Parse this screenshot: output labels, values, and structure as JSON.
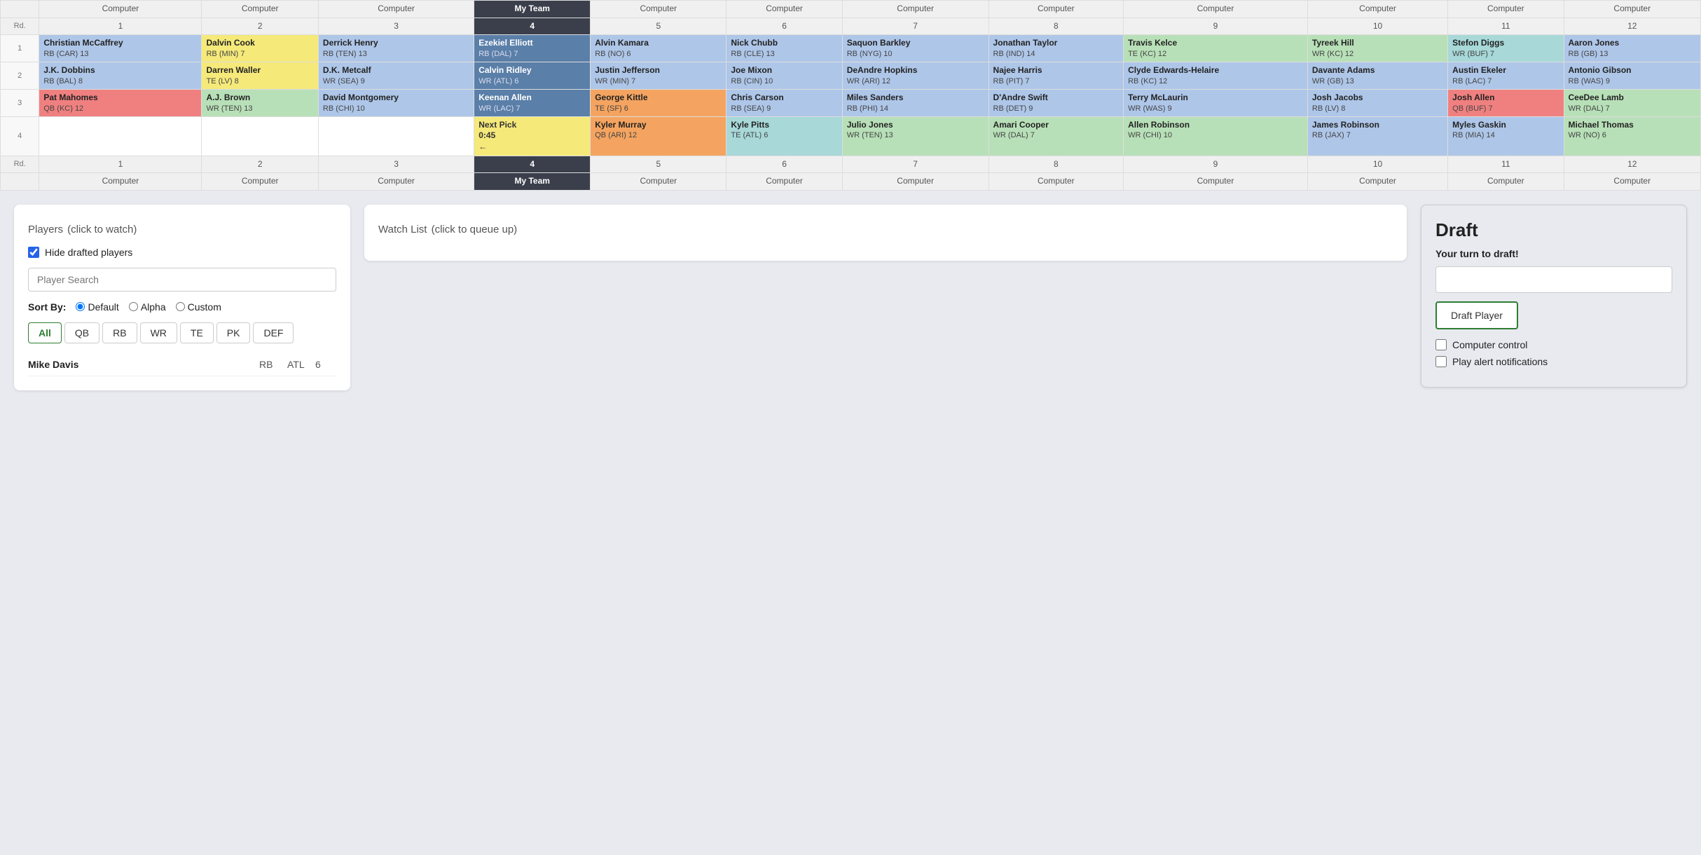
{
  "colors": {
    "my_team_header": "#3a3f4b",
    "blue": "#aec6e8",
    "green": "#b8e0b8",
    "yellow": "#f5e97a",
    "orange": "#f4a460",
    "red": "#f08080",
    "teal": "#a8d8d8"
  },
  "draft_board": {
    "headers": [
      "",
      "Computer",
      "Computer",
      "Computer",
      "My Team",
      "Computer",
      "Computer",
      "Computer",
      "Computer",
      "Computer",
      "Computer",
      "Computer",
      "Computer"
    ],
    "round_numbers": [
      "Rd.",
      "1",
      "2",
      "3",
      "4",
      "5",
      "6",
      "7",
      "8",
      "9",
      "10",
      "11",
      "12"
    ],
    "rounds": [
      {
        "round": "1",
        "picks": [
          {
            "name": "Christian McCaffrey",
            "meta": "RB (CAR) 13",
            "color": "blue"
          },
          {
            "name": "Dalvin Cook",
            "meta": "RB (MIN) 7",
            "color": "yellow"
          },
          {
            "name": "Derrick Henry",
            "meta": "RB (TEN) 13",
            "color": "blue"
          },
          {
            "name": "Ezekiel Elliott",
            "meta": "RB (DAL) 7",
            "color": "my-team",
            "is_my_team": true
          },
          {
            "name": "Alvin Kamara",
            "meta": "RB (NO) 6",
            "color": "blue"
          },
          {
            "name": "Nick Chubb",
            "meta": "RB (CLE) 13",
            "color": "blue"
          },
          {
            "name": "Saquon Barkley",
            "meta": "RB (NYG) 10",
            "color": "blue"
          },
          {
            "name": "Jonathan Taylor",
            "meta": "RB (IND) 14",
            "color": "blue"
          },
          {
            "name": "Travis Kelce",
            "meta": "TE (KC) 12",
            "color": "green"
          },
          {
            "name": "Tyreek Hill",
            "meta": "WR (KC) 12",
            "color": "green"
          },
          {
            "name": "Stefon Diggs",
            "meta": "WR (BUF) 7",
            "color": "teal"
          },
          {
            "name": "Aaron Jones",
            "meta": "RB (GB) 13",
            "color": "blue"
          }
        ]
      },
      {
        "round": "2",
        "picks": [
          {
            "name": "J.K. Dobbins",
            "meta": "RB (BAL) 8",
            "color": "blue"
          },
          {
            "name": "Darren Waller",
            "meta": "TE (LV) 8",
            "color": "yellow"
          },
          {
            "name": "D.K. Metcalf",
            "meta": "WR (SEA) 9",
            "color": "blue"
          },
          {
            "name": "Calvin Ridley",
            "meta": "WR (ATL) 6",
            "color": "my-team",
            "is_my_team": true
          },
          {
            "name": "Justin Jefferson",
            "meta": "WR (MIN) 7",
            "color": "blue"
          },
          {
            "name": "Joe Mixon",
            "meta": "RB (CIN) 10",
            "color": "blue"
          },
          {
            "name": "DeAndre Hopkins",
            "meta": "WR (ARI) 12",
            "color": "blue"
          },
          {
            "name": "Najee Harris",
            "meta": "RB (PIT) 7",
            "color": "blue"
          },
          {
            "name": "Clyde Edwards-Helaire",
            "meta": "RB (KC) 12",
            "color": "blue"
          },
          {
            "name": "Davante Adams",
            "meta": "WR (GB) 13",
            "color": "blue"
          },
          {
            "name": "Austin Ekeler",
            "meta": "RB (LAC) 7",
            "color": "blue"
          },
          {
            "name": "Antonio Gibson",
            "meta": "RB (WAS) 9",
            "color": "blue"
          }
        ]
      },
      {
        "round": "3",
        "picks": [
          {
            "name": "Pat Mahomes",
            "meta": "QB (KC) 12",
            "color": "red"
          },
          {
            "name": "A.J. Brown",
            "meta": "WR (TEN) 13",
            "color": "green"
          },
          {
            "name": "David Montgomery",
            "meta": "RB (CHI) 10",
            "color": "blue"
          },
          {
            "name": "Keenan Allen",
            "meta": "WR (LAC) 7",
            "color": "my-team",
            "is_my_team": true
          },
          {
            "name": "George Kittle",
            "meta": "TE (SF) 6",
            "color": "orange"
          },
          {
            "name": "Chris Carson",
            "meta": "RB (SEA) 9",
            "color": "blue"
          },
          {
            "name": "Miles Sanders",
            "meta": "RB (PHI) 14",
            "color": "blue"
          },
          {
            "name": "D'Andre Swift",
            "meta": "RB (DET) 9",
            "color": "blue"
          },
          {
            "name": "Terry McLaurin",
            "meta": "WR (WAS) 9",
            "color": "blue"
          },
          {
            "name": "Josh Jacobs",
            "meta": "RB (LV) 8",
            "color": "blue"
          },
          {
            "name": "Josh Allen",
            "meta": "QB (BUF) 7",
            "color": "red"
          },
          {
            "name": "CeeDee Lamb",
            "meta": "WR (DAL) 7",
            "color": "green"
          }
        ]
      },
      {
        "round": "4",
        "is_next_pick_round": true,
        "picks": [
          {
            "name": "",
            "meta": "",
            "color": "empty"
          },
          {
            "name": "",
            "meta": "",
            "color": "empty"
          },
          {
            "name": "",
            "meta": "",
            "color": "empty"
          },
          {
            "name": "next_pick",
            "meta": "Next Pick 0:45",
            "color": "yellow",
            "is_next_pick": true
          },
          {
            "name": "Kyler Murray",
            "meta": "QB (ARI) 12",
            "color": "orange"
          },
          {
            "name": "Kyle Pitts",
            "meta": "TE (ATL) 6",
            "color": "teal"
          },
          {
            "name": "Julio Jones",
            "meta": "WR (TEN) 13",
            "color": "green"
          },
          {
            "name": "Amari Cooper",
            "meta": "WR (DAL) 7",
            "color": "green"
          },
          {
            "name": "Allen Robinson",
            "meta": "WR (CHI) 10",
            "color": "green"
          },
          {
            "name": "James Robinson",
            "meta": "RB (JAX) 7",
            "color": "blue"
          },
          {
            "name": "Myles Gaskin",
            "meta": "RB (MIA) 14",
            "color": "blue"
          },
          {
            "name": "Michael Thomas",
            "meta": "WR (NO) 6",
            "color": "green"
          }
        ]
      }
    ],
    "bottom_round_numbers": [
      "Rd.",
      "1",
      "2",
      "3",
      "4",
      "5",
      "6",
      "7",
      "8",
      "9",
      "10",
      "11",
      "12"
    ],
    "bottom_headers": [
      "",
      "Computer",
      "Computer",
      "Computer",
      "My Team",
      "Computer",
      "Computer",
      "Computer",
      "Computer",
      "Computer",
      "Computer",
      "Computer",
      "Computer"
    ]
  },
  "players_panel": {
    "title": "Players",
    "subtitle": "(click to watch)",
    "hide_drafted_label": "Hide drafted players",
    "hide_drafted_checked": true,
    "search_placeholder": "Player Search",
    "sort_label": "Sort By:",
    "sort_options": [
      {
        "label": "Default",
        "value": "default",
        "checked": true
      },
      {
        "label": "Alpha",
        "value": "alpha",
        "checked": false
      },
      {
        "label": "Custom",
        "value": "custom",
        "checked": false
      }
    ],
    "filter_tabs": [
      {
        "label": "All",
        "active": true
      },
      {
        "label": "QB",
        "active": false
      },
      {
        "label": "RB",
        "active": false
      },
      {
        "label": "WR",
        "active": false
      },
      {
        "label": "TE",
        "active": false
      },
      {
        "label": "PK",
        "active": false
      },
      {
        "label": "DEF",
        "active": false
      }
    ],
    "players": [
      {
        "name": "Mike Davis",
        "pos": "RB",
        "team": "ATL",
        "rank": "6"
      }
    ]
  },
  "watchlist_panel": {
    "title": "Watch List",
    "subtitle": "(click to queue up)"
  },
  "draft_panel": {
    "title": "Draft",
    "your_turn_label": "Your turn to draft!",
    "input_placeholder": "",
    "draft_button_label": "Draft Player",
    "computer_control_label": "Computer control",
    "computer_control_checked": false,
    "play_alert_label": "Play alert notifications",
    "play_alert_checked": false
  }
}
